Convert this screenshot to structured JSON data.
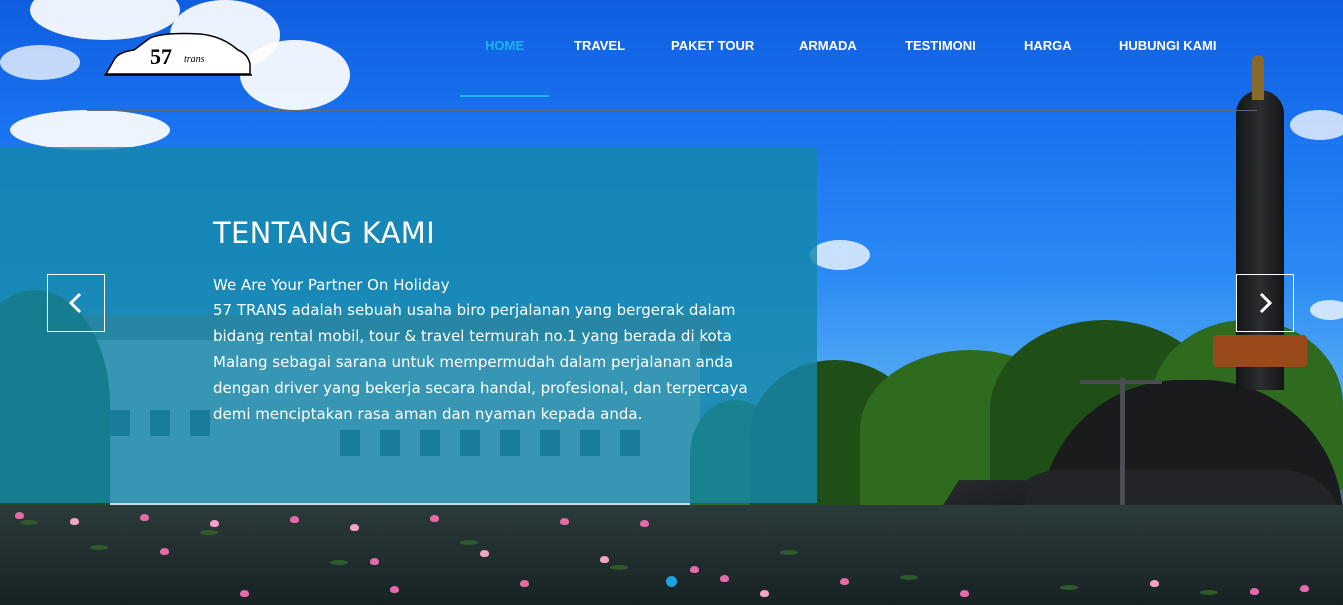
{
  "logo": {
    "number": "57",
    "word": "trans"
  },
  "nav": {
    "items": [
      {
        "label": "HOME",
        "active": true
      },
      {
        "label": "TRAVEL",
        "active": false
      },
      {
        "label": "PAKET TOUR",
        "active": false
      },
      {
        "label": "ARMADA",
        "active": false
      },
      {
        "label": "TESTIMONI",
        "active": false
      },
      {
        "label": "HARGA",
        "active": false
      },
      {
        "label": "HUBUNGI KAMI",
        "active": false
      }
    ]
  },
  "about": {
    "title": "TENTANG KAMI",
    "tagline": "We Are Your Partner On Holiday",
    "lines": [
      "57 TRANS adalah sebuah usaha biro perjalanan yang bergerak dalam",
      "bidang rental mobil, tour & travel termurah no.1 yang berada di kota",
      "Malang sebagai sarana untuk mempermudah dalam perjalanan anda",
      "dengan driver yang bekerja secara handal, profesional, dan terpercaya",
      "demi menciptakan rasa aman dan nyaman kepada anda."
    ]
  },
  "slider": {
    "prev_icon": "chevron-left-icon",
    "next_icon": "chevron-right-icon",
    "active_dot": 1
  },
  "colors": {
    "accent": "#1bb6e8",
    "panel": "#1487aa",
    "text": "#ffffff"
  }
}
